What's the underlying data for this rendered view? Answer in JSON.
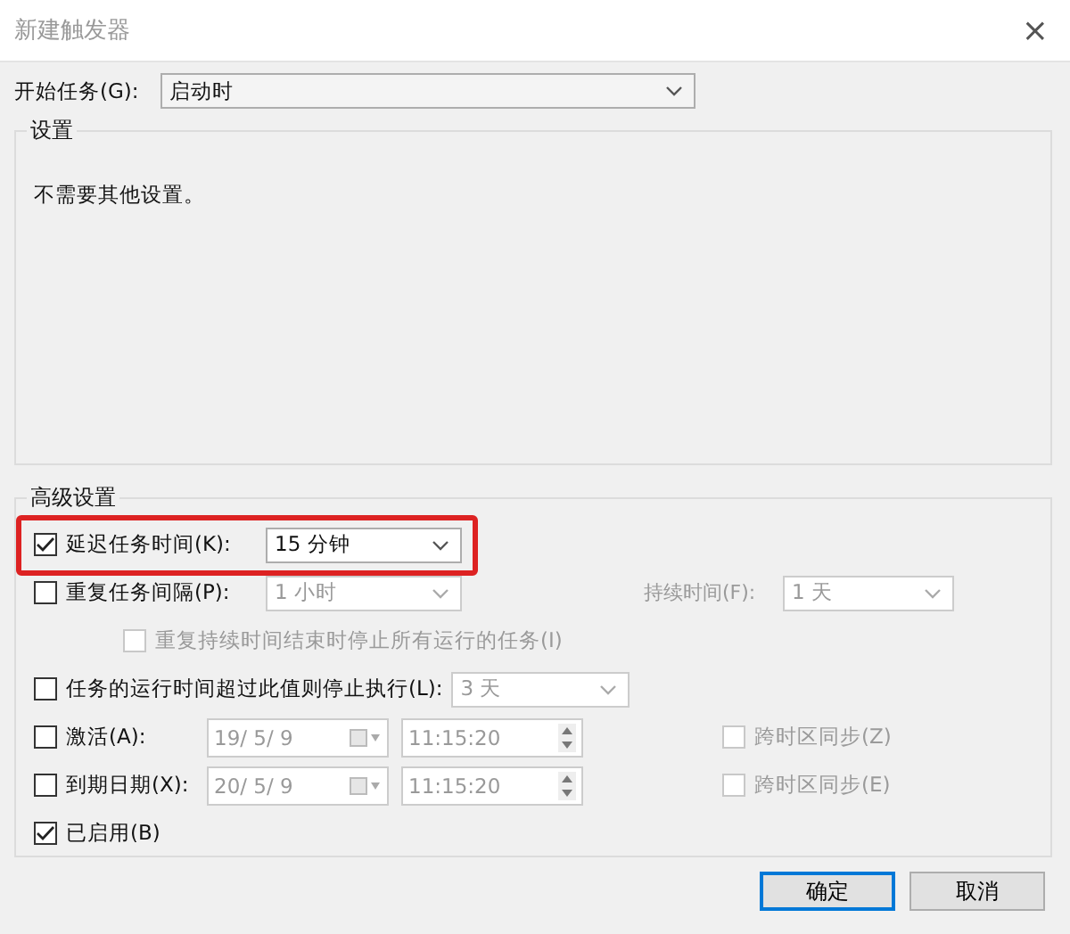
{
  "window": {
    "title": "新建触发器",
    "close": "×"
  },
  "start_task": {
    "label": "开始任务(G):",
    "value": "启动时"
  },
  "settings": {
    "legend": "设置",
    "text": "不需要其他设置。"
  },
  "advanced": {
    "legend": "高级设置",
    "rows": [
      {
        "kind": "select",
        "checked": true,
        "highlighted": true,
        "label": "延迟任务时间(K):",
        "value": "15 分钟",
        "disabled": false
      },
      {
        "kind": "repeat",
        "checked": false,
        "label": "重复任务间隔(P):",
        "value": "1 小时",
        "disabled": true,
        "duration_label": "持续时间(F):",
        "duration_value": "1 天"
      },
      {
        "kind": "sub",
        "checked": false,
        "disabled": true,
        "label": "重复持续时间结束时停止所有运行的任务(I)"
      },
      {
        "kind": "select",
        "checked": false,
        "label": "任务的运行时间超过此值则停止执行(L):",
        "value": "3 天",
        "disabled": true
      },
      {
        "kind": "datetime",
        "checked": false,
        "label": "激活(A):",
        "date": "19/ 5/ 9",
        "time": "11:15:20",
        "sync_label": "跨时区同步(Z)",
        "sync_checked": false,
        "disabled": true
      },
      {
        "kind": "datetime",
        "checked": false,
        "label": "到期日期(X):",
        "date": "20/ 5/ 9",
        "time": "11:15:20",
        "sync_label": "跨时区同步(E)",
        "sync_checked": false,
        "disabled": true
      },
      {
        "kind": "check",
        "checked": true,
        "label": "已启用(B)"
      }
    ]
  },
  "buttons": [
    {
      "label": "确定",
      "default": true
    },
    {
      "label": "取消",
      "default": false
    }
  ]
}
